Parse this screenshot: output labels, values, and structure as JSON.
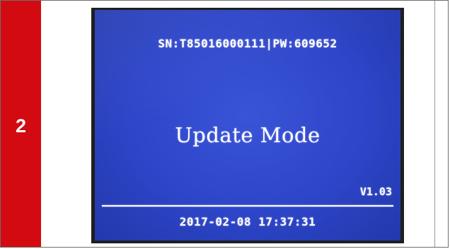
{
  "step": {
    "number": "2",
    "color": "#d40a12"
  },
  "display": {
    "serial_line": "SN:T85016000111|PW:609652",
    "mode_title": "Update Mode",
    "version": "V1.03",
    "timestamp": "2017-02-08 17:37:31",
    "background_color": "#2d45c8",
    "text_color": "#ffffff"
  }
}
